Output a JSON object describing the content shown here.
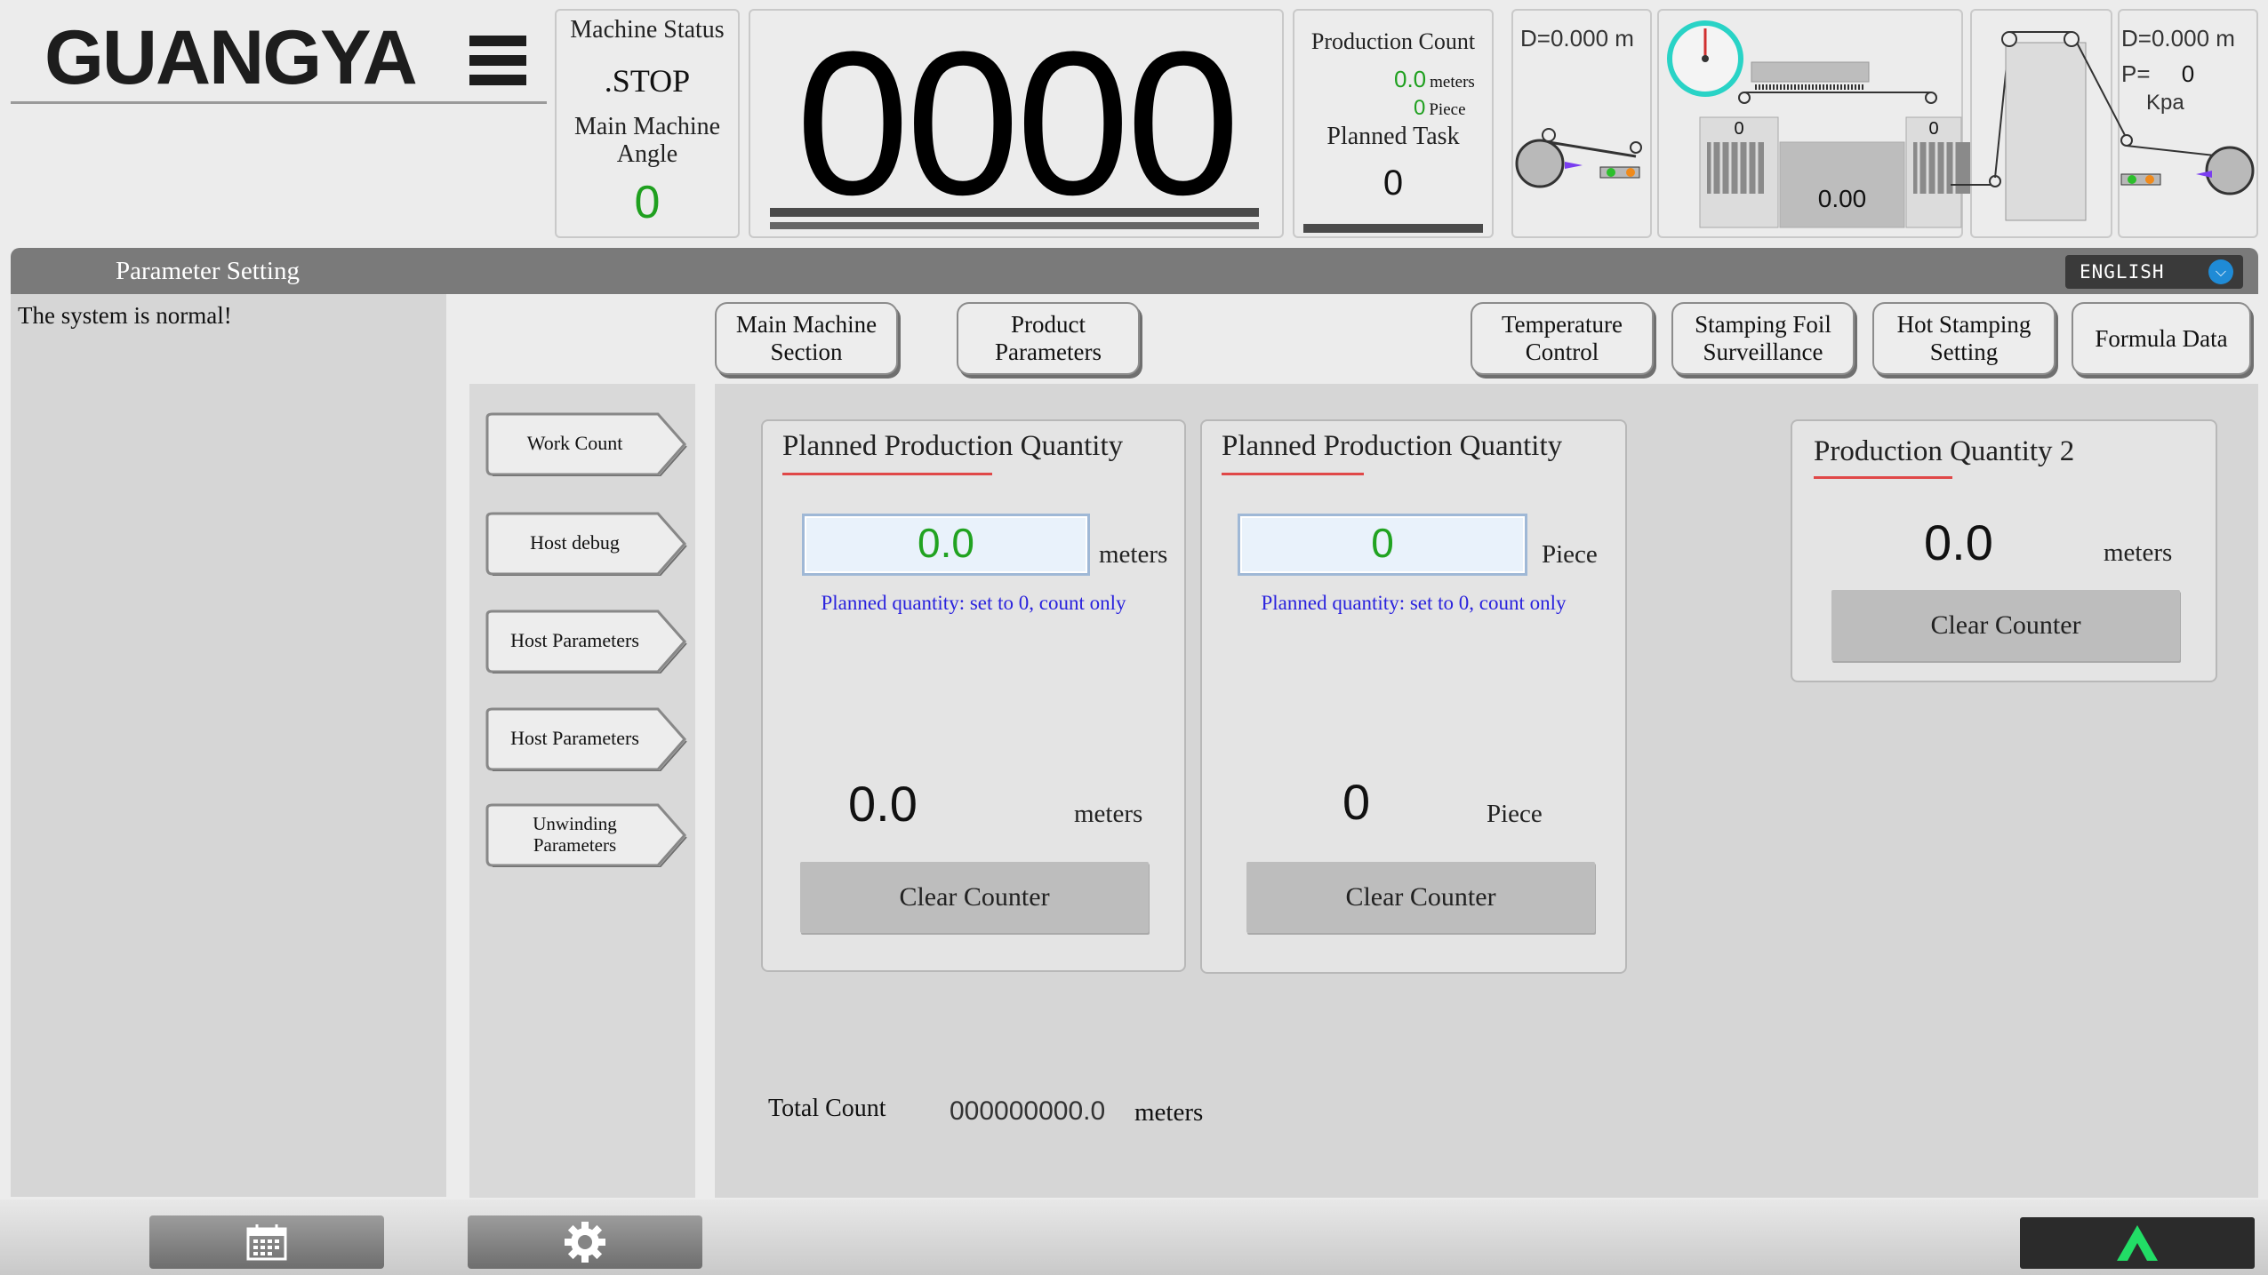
{
  "logo": {
    "text": "GUANGYA"
  },
  "machine": {
    "status_label": "Machine Status",
    "status_value": ".STOP",
    "angle_label": "Main Machine\nAngle",
    "angle_value": "0"
  },
  "big_counter": "0000",
  "production": {
    "count_label": "Production Count",
    "meters_value": "0.0",
    "meters_unit": "meters",
    "piece_value": "0",
    "piece_unit": "Piece",
    "planned_task_label": "Planned Task",
    "planned_task_value": "0"
  },
  "diagram": {
    "left_diameter_prefix": "D=",
    "left_diameter_value": "0.000",
    "left_diameter_unit": "m",
    "left_heater_value": "0",
    "right_heater_value": "0",
    "center_value": "0.00",
    "right_diameter_prefix": "D=",
    "right_diameter_value": "0.000",
    "right_diameter_unit": "m",
    "pressure_prefix": "P=",
    "pressure_value": "0",
    "pressure_unit": "Kpa"
  },
  "header": {
    "title": "Parameter Setting",
    "language": "ENGLISH"
  },
  "system_message": "The system is normal!",
  "nav": {
    "main_machine": "Main Machine\nSection",
    "product_params": "Product\nParameters",
    "temperature": "Temperature\nControl",
    "stamping_foil": "Stamping Foil\nSurveillance",
    "hot_stamping": "Hot Stamping\nSetting",
    "formula": "Formula Data"
  },
  "side_menu": {
    "work_count": "Work Count",
    "host_debug": "Host debug",
    "host_params_1": "Host Parameters",
    "host_params_2": "Host Parameters",
    "unwinding": "Unwinding\nParameters"
  },
  "card1": {
    "title": "Planned Production Quantity",
    "input_value": "0.0",
    "input_unit": "meters",
    "hint": "Planned quantity: set to 0, count only",
    "value": "0.0",
    "value_unit": "meters",
    "clear_label": "Clear Counter"
  },
  "card2": {
    "title": "Planned Production Quantity",
    "input_value": "0",
    "input_unit": "Piece",
    "hint": "Planned quantity: set to 0, count only",
    "value": "0",
    "value_unit": "Piece",
    "clear_label": "Clear Counter"
  },
  "card3": {
    "title": "Production Quantity 2",
    "value": "0.0",
    "value_unit": "meters",
    "clear_label": "Clear Counter"
  },
  "total": {
    "label": "Total Count",
    "value": "000000000.0",
    "unit": "meters"
  },
  "bottom": {
    "calendar_icon": "calendar-icon",
    "settings_icon": "gear-icon",
    "up_icon": "up-chevron-icon"
  },
  "colors": {
    "green_value": "#1fa01f",
    "hint_blue": "#2a22dd",
    "title_underline": "#e04848",
    "up_arrow": "#22dd66",
    "gauge_ring": "#29d3c6"
  }
}
